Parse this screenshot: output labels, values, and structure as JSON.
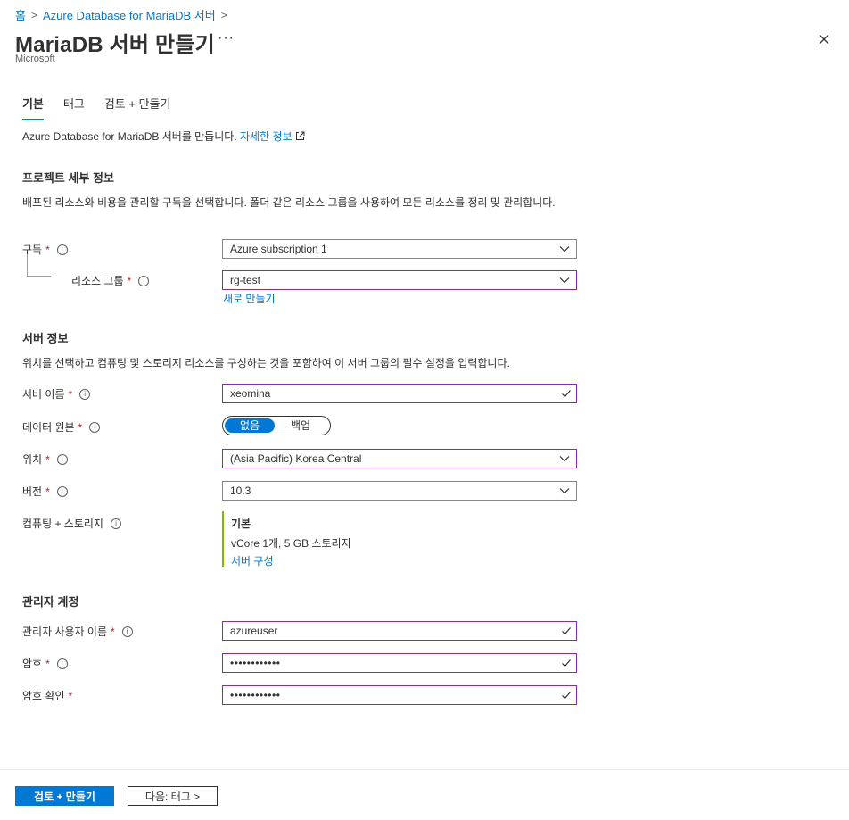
{
  "breadcrumb": {
    "home": "홈",
    "parent": "Azure Database for MariaDB 서버"
  },
  "header": {
    "title": "MariaDB 서버 만들기",
    "more": "···",
    "publisher": "Microsoft"
  },
  "tabs": [
    {
      "label": "기본",
      "active": true
    },
    {
      "label": "태그"
    },
    {
      "label": "검토 + 만들기"
    }
  ],
  "intro": {
    "text": "Azure Database for MariaDB 서버를 만듭니다. ",
    "link": "자세한 정보"
  },
  "project": {
    "heading": "프로젝트 세부 정보",
    "description": "배포된 리소스와 비용을 관리할 구독을 선택합니다. 폴더 같은 리소스 그룹을 사용하여 모든 리소스를 정리 및 관리합니다.",
    "subscription": {
      "label": "구독",
      "value": "Azure subscription 1"
    },
    "resource_group": {
      "label": "리소스 그룹",
      "value": "rg-test",
      "create_new": "새로 만들기"
    }
  },
  "server": {
    "heading": "서버 정보",
    "description": "위치를 선택하고 컴퓨팅 및 스토리지 리소스를 구성하는 것을 포함하여 이 서버 그룹의 필수 설정을 입력합니다.",
    "name": {
      "label": "서버 이름",
      "value": "xeomina"
    },
    "data_source": {
      "label": "데이터 원본",
      "option_none": "없음",
      "option_backup": "백업",
      "selected": "없음"
    },
    "location": {
      "label": "위치",
      "value": "(Asia Pacific) Korea Central"
    },
    "version": {
      "label": "버전",
      "value": "10.3"
    },
    "compute": {
      "label": "컴퓨팅 + 스토리지",
      "tier": "기본",
      "detail": "vCore 1개, 5 GB 스토리지",
      "configure": "서버 구성"
    }
  },
  "admin": {
    "heading": "관리자 계정",
    "username": {
      "label": "관리자 사용자 이름",
      "value": "azureuser"
    },
    "password": {
      "label": "암호",
      "value": "••••••••••••"
    },
    "confirm": {
      "label": "암호 확인",
      "value": "••••••••••••"
    }
  },
  "footer": {
    "review_create": "검토 + 만들기",
    "next": "다음: 태그 >"
  },
  "colors": {
    "accent": "#0078d4",
    "required": "#a4262c",
    "validated_border": "#8a2ca8",
    "compute_bar": "#7fba00"
  }
}
